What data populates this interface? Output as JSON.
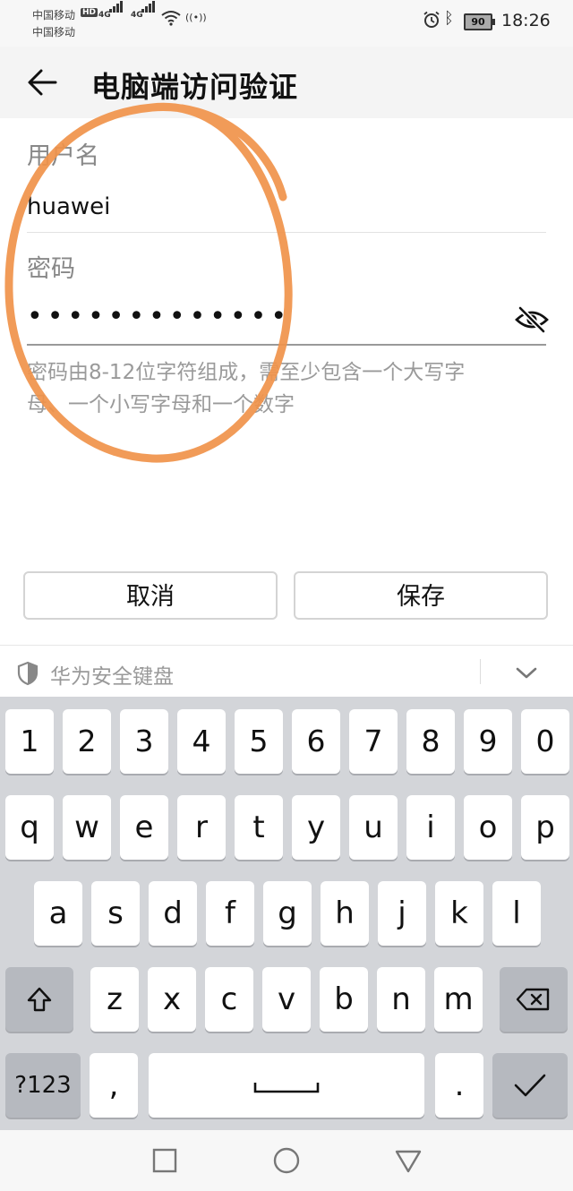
{
  "status_bar": {
    "carrier_1": "中国移动",
    "carrier_2": "中国移动",
    "hd_badge": "HD",
    "network_1": "4G",
    "network_2": "4G",
    "battery": "90",
    "time": "18:26",
    "icons": [
      "signal-icon",
      "wifi-icon",
      "hotspot-icon",
      "alarm-icon",
      "bluetooth-icon",
      "battery-icon"
    ]
  },
  "header": {
    "back_icon": "back-arrow-icon",
    "title": "电脑端访问验证"
  },
  "form": {
    "username_label": "用户名",
    "username_value": "huawei",
    "password_label": "密码",
    "password_value": "•••••••••••••",
    "password_toggle_icon": "eye-hidden-icon",
    "hint_line_1": "密码由8-12位字符组成，需至少包含一个大写字",
    "hint_line_2": "母、一个小写字母和一个数字",
    "cancel_label": "取消",
    "save_label": "保存"
  },
  "keyboard": {
    "title": "华为安全键盘",
    "shield_icon": "shield-icon",
    "collapse_icon": "chevron-down-icon",
    "row_numbers": [
      "1",
      "2",
      "3",
      "4",
      "5",
      "6",
      "7",
      "8",
      "9",
      "0"
    ],
    "row_1": [
      "q",
      "w",
      "e",
      "r",
      "t",
      "y",
      "u",
      "i",
      "o",
      "p"
    ],
    "row_2": [
      "a",
      "s",
      "d",
      "f",
      "g",
      "h",
      "j",
      "k",
      "l"
    ],
    "row_3": [
      "z",
      "x",
      "c",
      "v",
      "b",
      "n",
      "m"
    ],
    "shift_icon": "shift-icon",
    "backspace_icon": "backspace-icon",
    "symbols_label": "?123",
    "comma": ",",
    "space_icon": "space-icon",
    "period": ".",
    "enter_icon": "checkmark-icon"
  },
  "nav_bar": {
    "icons": [
      "recent-apps-icon",
      "home-icon",
      "back-icon"
    ]
  },
  "colors": {
    "annotation": "#f0924a",
    "keyboard_bg": "#d3d5d9",
    "key_bg": "#ffffff",
    "key_dark_bg": "#b6b9bf"
  }
}
